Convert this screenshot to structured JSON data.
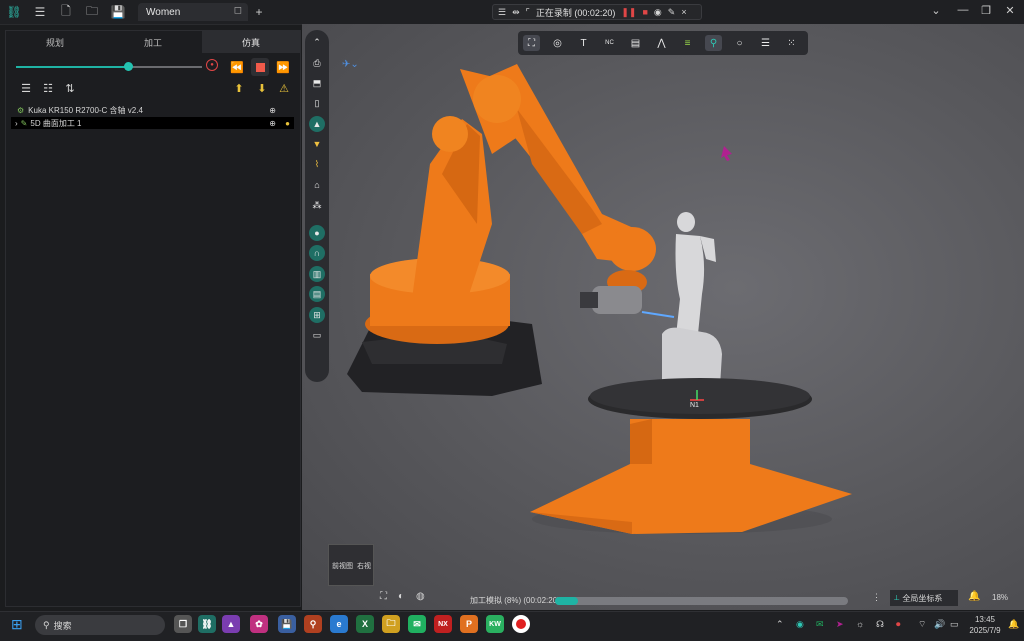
{
  "titlebar": {
    "tab_label": "Women",
    "tab_close": "◻",
    "add_tab": "+",
    "recording_text": "正在录制 (00:02:20)"
  },
  "left_panel": {
    "tabs": [
      "规划",
      "加工",
      "仿真"
    ],
    "active_tab_index": 2,
    "slider_progress": 0.6,
    "tree": [
      {
        "label": "Kuka KR150 R2700-C 含轴 v2.4"
      },
      {
        "label": "5D 曲面加工 1"
      }
    ]
  },
  "viewport": {
    "tool_label": "N1",
    "viewcube_front": "前视图",
    "viewcube_right": "右视",
    "progress_text": "加工模拟 (8%) (00:02:20)",
    "progress_value": 0.08,
    "coord_button": "全局坐标系",
    "zoom_text": "18%"
  },
  "taskbar": {
    "search_placeholder": "搜索",
    "time": "13:45",
    "date": "2025/7/9",
    "apps": [
      "NX",
      "P",
      "KW"
    ]
  },
  "colors": {
    "accent": "#1fb3a4",
    "robot": "#ee7a1a",
    "record": "#e04646"
  }
}
